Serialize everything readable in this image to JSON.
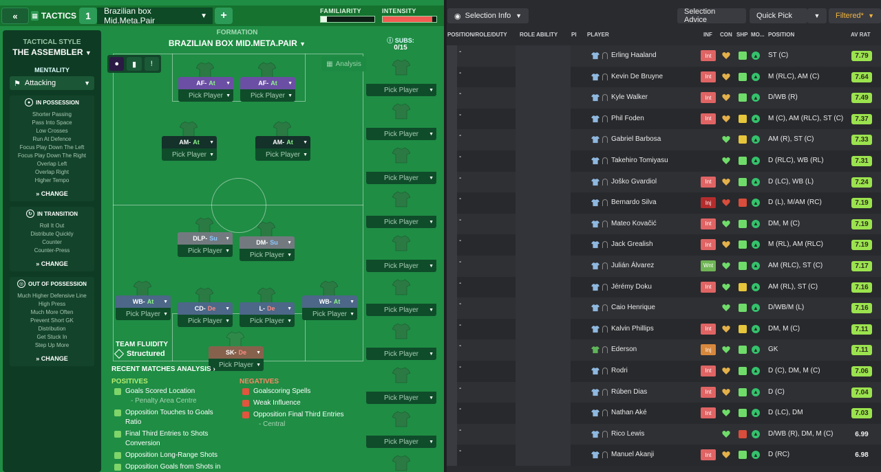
{
  "topbar": {
    "tactics_label": "TACTICS",
    "slot_number": "1",
    "tactic_name": "Brazilian box Mid.Meta.Pair",
    "familiarity_label": "FAMILIARITY",
    "familiarity_level": 0.12,
    "intensity_label": "INTENSITY",
    "intensity_level": 0.92
  },
  "style": {
    "label": "TACTICAL STYLE",
    "value": "THE ASSEMBLER",
    "mentality_label": "MENTALITY",
    "mentality_value": "Attacking",
    "in_possession": {
      "title": "IN POSSESSION",
      "items": [
        "Shorter Passing",
        "Pass Into Space",
        "Low Crosses",
        "Run At Defence",
        "Focus Play Down The Left",
        "Focus Play Down The Right",
        "Overlap Left",
        "Overlap Right",
        "Higher Tempo"
      ],
      "change": "CHANGE"
    },
    "in_transition": {
      "title": "IN TRANSITION",
      "items": [
        "Roll It Out",
        "Distribute Quickly",
        "Counter",
        "Counter-Press"
      ],
      "change": "CHANGE"
    },
    "out_of_possession": {
      "title": "OUT OF POSSESSION",
      "items": [
        "Much Higher Defensive Line",
        "High Press",
        "Much More Often",
        "Prevent Short GK",
        "Distribution",
        "Get Stuck In",
        "Step Up More"
      ],
      "change": "CHANGE"
    }
  },
  "formation": {
    "label": "FORMATION",
    "name": "BRAZILIAN BOX MID.META.PAIR",
    "subs_label": "SUBS:",
    "subs_count": "0/15",
    "analysis": "Analysis",
    "fluidity_label": "TEAM FLUIDITY",
    "fluidity_value": "Structured",
    "pick_label": "Pick Player",
    "positions": [
      {
        "role": "AF",
        "duty": "At",
        "duty_class": "at",
        "color": "r-purple"
      },
      {
        "role": "AF",
        "duty": "At",
        "duty_class": "at",
        "color": "r-purple"
      },
      {
        "role": "AM",
        "duty": "At",
        "duty_class": "at",
        "color": "r-dark"
      },
      {
        "role": "AM",
        "duty": "At",
        "duty_class": "at",
        "color": "r-dark"
      },
      {
        "role": "DLP",
        "duty": "Su",
        "duty_class": "su",
        "color": "r-gray"
      },
      {
        "role": "DM",
        "duty": "Su",
        "duty_class": "su",
        "color": "r-gray"
      },
      {
        "role": "WB",
        "duty": "At",
        "duty_class": "at",
        "color": "r-blue"
      },
      {
        "role": "CD",
        "duty": "De",
        "duty_class": "de",
        "color": "r-blue"
      },
      {
        "role": "L",
        "duty": "De",
        "duty_class": "de",
        "color": "r-blue"
      },
      {
        "role": "WB",
        "duty": "At",
        "duty_class": "at",
        "color": "r-blue"
      },
      {
        "role": "SK",
        "duty": "De",
        "duty_class": "de",
        "color": "r-brown"
      }
    ]
  },
  "analysis": {
    "title": "RECENT MATCHES ANALYSIS",
    "positives_label": "POSITIVES",
    "negatives_label": "NEGATIVES",
    "positives": [
      {
        "text": "Goals Scored Location",
        "sub": "- Penalty Area Centre"
      },
      {
        "text": "Opposition Touches to Goals Ratio",
        "sub": ""
      },
      {
        "text": "Final Third Entries to Shots Conversion",
        "sub": ""
      },
      {
        "text": "Opposition Long-Range Shots",
        "sub": ""
      },
      {
        "text": "Opposition Goals from Shots in",
        "sub": ""
      }
    ],
    "negatives": [
      {
        "text": "Goalscoring Spells",
        "sub": ""
      },
      {
        "text": "Weak Influence",
        "sub": ""
      },
      {
        "text": "Opposition Final Third Entries",
        "sub": "- Central"
      }
    ]
  },
  "right_toolbar": {
    "selection_info": "Selection Info",
    "selection_advice": "Selection Advice",
    "quick_pick": "Quick Pick",
    "filtered": "Filtered*"
  },
  "table": {
    "headers": [
      "POSITION/ROLE/DUTY",
      "ROLE ABILITY",
      "PI",
      "PLAYER",
      "INF",
      "CON",
      "SHP",
      "MO...",
      "POSITION",
      "AV RAT"
    ],
    "rows": [
      {
        "name": "Erling Haaland",
        "inf": "Int",
        "inf_class": "inf-int",
        "con": "gold",
        "shp": "green",
        "position": "ST (C)",
        "rating": "7.79",
        "rate_class": "g"
      },
      {
        "name": "Kevin De Bruyne",
        "inf": "Int",
        "inf_class": "inf-int",
        "con": "gold",
        "shp": "green",
        "position": "M (RLC), AM (C)",
        "rating": "7.64",
        "rate_class": "g"
      },
      {
        "name": "Kyle Walker",
        "inf": "Int",
        "inf_class": "inf-int",
        "con": "gold",
        "shp": "green",
        "position": "D/WB (R)",
        "rating": "7.49",
        "rate_class": "g"
      },
      {
        "name": "Phil Foden",
        "inf": "Int",
        "inf_class": "inf-int",
        "con": "gold",
        "shp": "yellow",
        "position": "M (C), AM (RLC), ST (C)",
        "rating": "7.37",
        "rate_class": "g"
      },
      {
        "name": "Gabriel Barbosa",
        "inf": "",
        "inf_class": "",
        "con": "green",
        "shp": "yellow",
        "position": "AM (R), ST (C)",
        "rating": "7.33",
        "rate_class": "g"
      },
      {
        "name": "Takehiro Tomiyasu",
        "inf": "",
        "inf_class": "",
        "con": "green",
        "shp": "green",
        "position": "D (RLC), WB (RL)",
        "rating": "7.31",
        "rate_class": "g"
      },
      {
        "name": "Joško Gvardiol",
        "inf": "Int",
        "inf_class": "inf-int",
        "con": "gold",
        "shp": "green",
        "position": "D (LC), WB (L)",
        "rating": "7.24",
        "rate_class": "g"
      },
      {
        "name": "Bernardo Silva",
        "inf": "Inj",
        "inf_class": "inf-inj",
        "con": "red",
        "shp": "red",
        "position": "D (L), M/AM (RC)",
        "rating": "7.19",
        "rate_class": "g"
      },
      {
        "name": "Mateo Kovačić",
        "inf": "Int",
        "inf_class": "inf-int",
        "con": "green",
        "shp": "green",
        "position": "DM, M (C)",
        "rating": "7.19",
        "rate_class": "g"
      },
      {
        "name": "Jack Grealish",
        "inf": "Int",
        "inf_class": "inf-int",
        "con": "gold",
        "shp": "green",
        "position": "M (RL), AM (RLC)",
        "rating": "7.19",
        "rate_class": "g"
      },
      {
        "name": "Julián Álvarez",
        "inf": "Wnt",
        "inf_class": "inf-wnt",
        "con": "green",
        "shp": "green",
        "position": "AM (RLC), ST (C)",
        "rating": "7.17",
        "rate_class": "g"
      },
      {
        "name": "Jérémy Doku",
        "inf": "Int",
        "inf_class": "inf-int",
        "con": "green",
        "shp": "yellow",
        "position": "AM (RL), ST (C)",
        "rating": "7.16",
        "rate_class": "g"
      },
      {
        "name": "Caio Henrique",
        "inf": "",
        "inf_class": "",
        "con": "green",
        "shp": "green",
        "position": "D/WB/M (L)",
        "rating": "7.16",
        "rate_class": "g"
      },
      {
        "name": "Kalvin Phillips",
        "inf": "Int",
        "inf_class": "inf-int",
        "con": "gold",
        "shp": "yellow",
        "position": "DM, M (C)",
        "rating": "7.11",
        "rate_class": "g"
      },
      {
        "name": "Ederson",
        "inf": "Inj",
        "inf_class": "inf-inji",
        "con": "green",
        "shp": "green",
        "position": "GK",
        "rating": "7.11",
        "rate_class": "g"
      },
      {
        "name": "Rodri",
        "inf": "Int",
        "inf_class": "inf-int",
        "con": "gold",
        "shp": "green",
        "position": "D (C), DM, M (C)",
        "rating": "7.06",
        "rate_class": "g"
      },
      {
        "name": "Rúben Dias",
        "inf": "Int",
        "inf_class": "inf-int",
        "con": "gold",
        "shp": "green",
        "position": "D (C)",
        "rating": "7.04",
        "rate_class": "g"
      },
      {
        "name": "Nathan Aké",
        "inf": "Int",
        "inf_class": "inf-int",
        "con": "green",
        "shp": "green",
        "position": "D (LC), DM",
        "rating": "7.03",
        "rate_class": "g"
      },
      {
        "name": "Rico Lewis",
        "inf": "",
        "inf_class": "",
        "con": "green",
        "shp": "red",
        "position": "D/WB (R), DM, M (C)",
        "rating": "6.99",
        "rate_class": "n"
      },
      {
        "name": "Manuel Akanji",
        "inf": "Int",
        "inf_class": "inf-int",
        "con": "gold",
        "shp": "green",
        "position": "D (RC)",
        "rating": "6.98",
        "rate_class": "n"
      }
    ]
  }
}
